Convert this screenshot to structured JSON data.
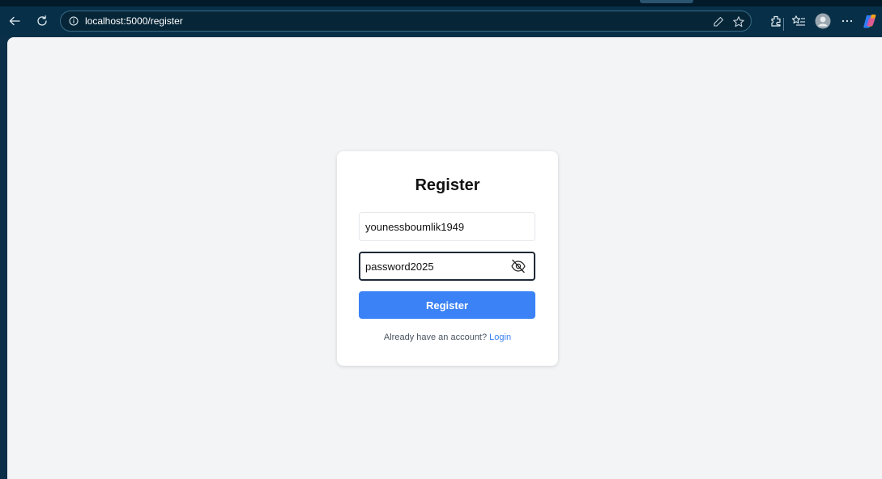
{
  "browser": {
    "url": "localhost:5000/register"
  },
  "form": {
    "title": "Register",
    "username_value": "younessboumlik1949",
    "password_value": "password2025",
    "submit_label": "Register",
    "login_prompt": "Already have an account?",
    "login_link": "Login"
  },
  "colors": {
    "browser_chrome": "#073048",
    "page_background": "#f3f4f6",
    "primary_button": "#3b82f6",
    "link": "#3b82f6"
  },
  "icons": {
    "back": "back-arrow-icon",
    "refresh": "refresh-icon",
    "site_info": "info-circle-icon",
    "read_aloud": "read-aloud-icon",
    "favorite": "star-icon",
    "extensions": "extensions-icon",
    "favorites_list": "favorites-list-icon",
    "profile": "profile-avatar-icon",
    "more": "more-icon",
    "copilot": "copilot-icon",
    "password_toggle": "eye-off-icon"
  }
}
